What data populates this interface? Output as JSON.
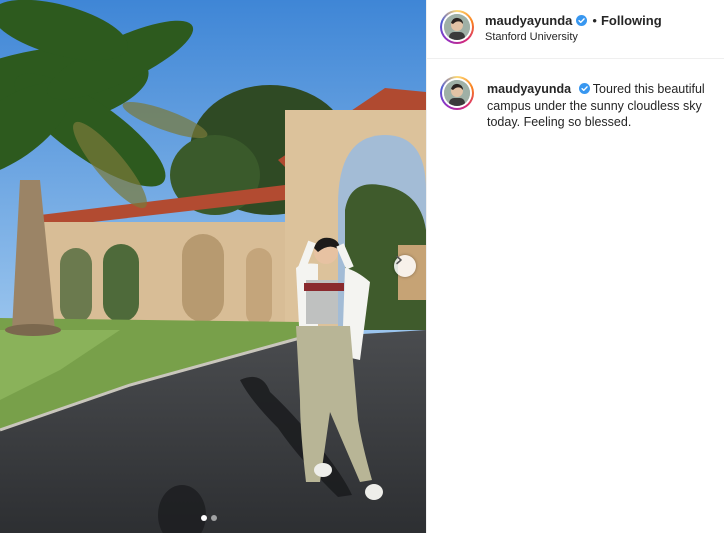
{
  "post": {
    "username": "maudyayunda",
    "verified": true,
    "separator": "•",
    "follow_status": "Following",
    "location": "Stanford University",
    "caption": "Toured this beautiful campus under the sunny cloudless sky today. Feeling so blessed."
  },
  "carousel": {
    "slide_count": 2,
    "active_slide": 1,
    "next_icon": "chevron-right-icon"
  },
  "colors": {
    "verified_badge": "#3897f0",
    "sky": "#5e9fe0",
    "story_ring": "#d62976"
  }
}
